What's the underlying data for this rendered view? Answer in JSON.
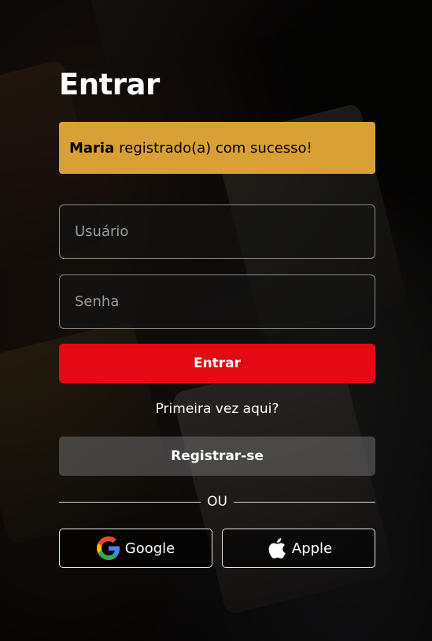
{
  "page": {
    "title": "Entrar"
  },
  "alert": {
    "user": "Maria",
    "message": "registrado(a) com sucesso!"
  },
  "form": {
    "username_placeholder": "Usuário",
    "password_placeholder": "Senha",
    "submit_label": "Entrar"
  },
  "register": {
    "prompt": "Primeira vez aqui?",
    "button_label": "Registrar-se"
  },
  "divider": {
    "label": "OU"
  },
  "social": {
    "google_label": "Google",
    "google_icon": "google-g-icon",
    "apple_label": "Apple",
    "apple_icon": "apple-logo-icon"
  },
  "colors": {
    "primary": "#e50914",
    "alert": "#d9a036",
    "secondary": "#6e6e6e"
  }
}
